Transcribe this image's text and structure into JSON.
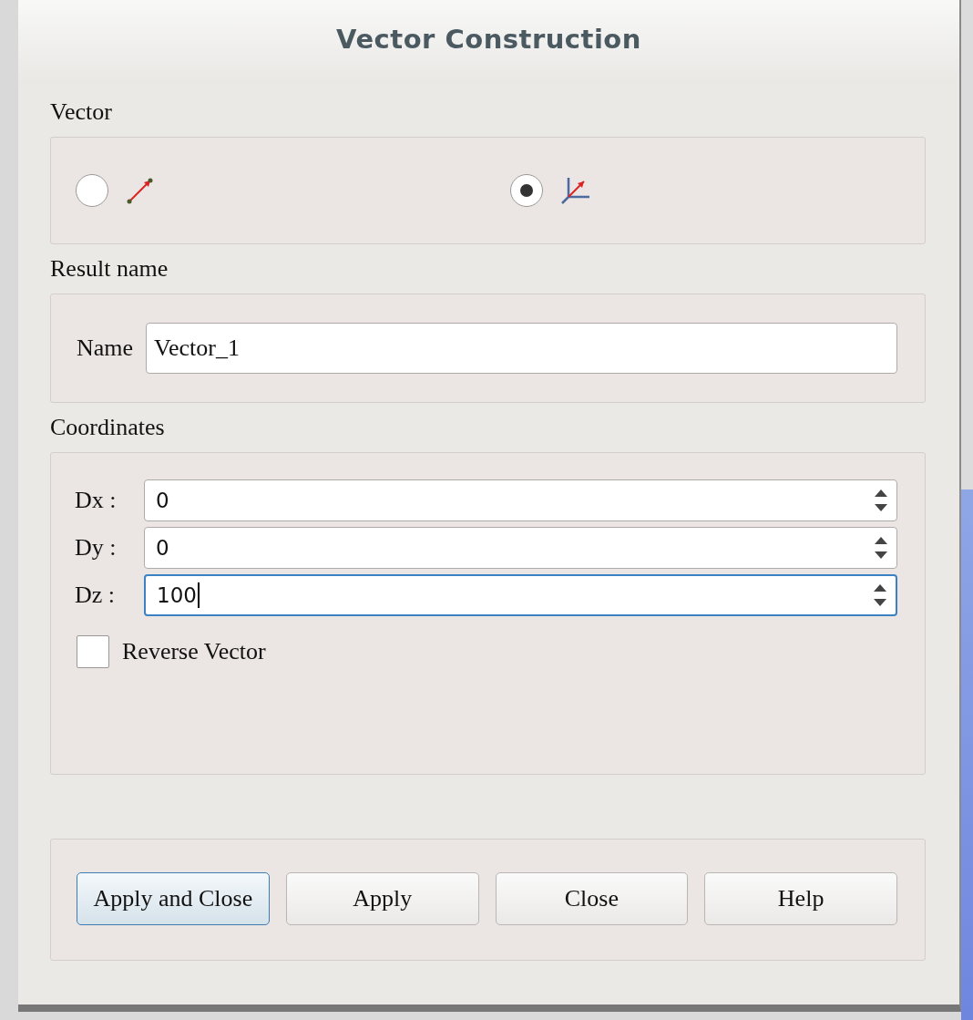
{
  "window": {
    "title": "Vector Construction"
  },
  "vector": {
    "label": "Vector",
    "options": [
      {
        "kind": "two-points",
        "selected": false
      },
      {
        "kind": "components",
        "selected": true
      }
    ]
  },
  "result_name": {
    "label": "Result name",
    "field_label": "Name",
    "value": "Vector_1"
  },
  "coordinates": {
    "label": "Coordinates",
    "fields": [
      {
        "label": "Dx :",
        "value": "0",
        "focused": false
      },
      {
        "label": "Dy :",
        "value": "0",
        "focused": false
      },
      {
        "label": "Dz :",
        "value": "100",
        "focused": true
      }
    ],
    "reverse": {
      "label": "Reverse Vector",
      "checked": false
    }
  },
  "buttons": [
    {
      "label": "Apply and Close",
      "default": true
    },
    {
      "label": "Apply",
      "default": false
    },
    {
      "label": "Close",
      "default": false
    },
    {
      "label": "Help",
      "default": false
    }
  ]
}
